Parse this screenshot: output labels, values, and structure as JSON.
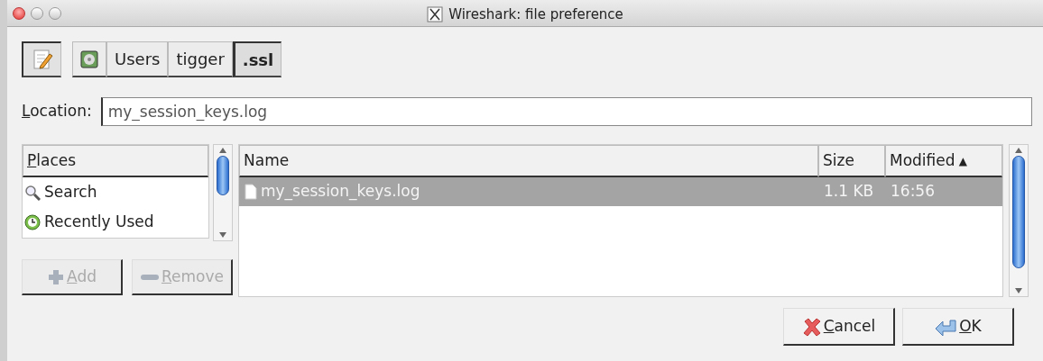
{
  "window": {
    "title": "Wireshark: file preference",
    "buttons": [
      {
        "kind": "close"
      },
      {
        "kind": "minimize"
      },
      {
        "kind": "zoom"
      }
    ]
  },
  "path_bar": {
    "edit_toggle": {
      "selected": true
    },
    "segments": [
      {
        "kind": "drive",
        "selected": false
      },
      {
        "kind": "folder",
        "label": "Users",
        "selected": false
      },
      {
        "kind": "folder",
        "label": "tigger",
        "selected": false
      },
      {
        "kind": "folder",
        "label": ".ssl",
        "selected": true
      }
    ]
  },
  "location": {
    "label": "Location:",
    "mnemonic": true,
    "value": "my_session_keys.log"
  },
  "places": {
    "header": "Places",
    "mnemonic": true,
    "items": [
      {
        "kind": "search",
        "label": "Search"
      },
      {
        "kind": "recent",
        "label": "Recently Used"
      }
    ]
  },
  "place_buttons": [
    {
      "kind": "add",
      "label": "Add",
      "mnemonic": true,
      "disabled": true
    },
    {
      "kind": "remove",
      "label": "Remove",
      "mnemonic": true,
      "disabled": true
    }
  ],
  "files": {
    "columns": [
      {
        "label": "Name"
      },
      {
        "label": "Size"
      },
      {
        "label": "Modified",
        "sort": "▲"
      }
    ],
    "rows": [
      {
        "name": "my_session_keys.log",
        "size": "1.1 KB",
        "modified": "16:56",
        "selected": true
      }
    ]
  },
  "dialog_buttons": [
    {
      "kind": "cancel",
      "label": "Cancel",
      "mnemonic": true
    },
    {
      "kind": "ok",
      "label": "OK",
      "mnemonic": true
    }
  ]
}
